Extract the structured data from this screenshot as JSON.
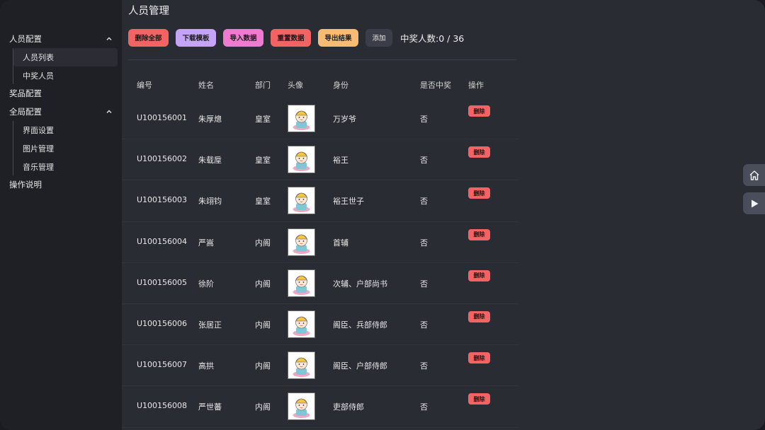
{
  "sidebar": {
    "groups": [
      {
        "label": "人员配置",
        "items": [
          "人员列表",
          "中奖人员"
        ]
      },
      {
        "label": "奖品配置"
      },
      {
        "label": "全局配置",
        "items": [
          "界面设置",
          "图片管理",
          "音乐管理"
        ]
      },
      {
        "label": "操作说明"
      }
    ]
  },
  "header": {
    "title": "人员管理"
  },
  "toolbar": {
    "delete_all": "删除全部",
    "download_template": "下载模板",
    "import_data": "导入数据",
    "reset_data": "重置数据",
    "export_results": "导出结果",
    "add": "添加",
    "winners_label": "中奖人数:0 / 36"
  },
  "table": {
    "headers": [
      "编号",
      "姓名",
      "部门",
      "头像",
      "身份",
      "是否中奖",
      "操作"
    ],
    "rows": [
      {
        "id": "U100156001",
        "name": "朱厚熜",
        "dept": "皇室",
        "role": "万岁爷",
        "won": "否",
        "action": "删除"
      },
      {
        "id": "U100156002",
        "name": "朱载垕",
        "dept": "皇室",
        "role": "裕王",
        "won": "否",
        "action": "删除"
      },
      {
        "id": "U100156003",
        "name": "朱翊钧",
        "dept": "皇室",
        "role": "裕王世子",
        "won": "否",
        "action": "删除"
      },
      {
        "id": "U100156004",
        "name": "严嵩",
        "dept": "内阁",
        "role": "首辅",
        "won": "否",
        "action": "删除"
      },
      {
        "id": "U100156005",
        "name": "徐阶",
        "dept": "内阁",
        "role": "次辅、户部尚书",
        "won": "否",
        "action": "删除"
      },
      {
        "id": "U100156006",
        "name": "张居正",
        "dept": "内阁",
        "role": "阁臣、兵部侍郎",
        "won": "否",
        "action": "删除"
      },
      {
        "id": "U100156007",
        "name": "高拱",
        "dept": "内阁",
        "role": "阁臣、户部侍郎",
        "won": "否",
        "action": "删除"
      },
      {
        "id": "U100156008",
        "name": "严世蕃",
        "dept": "内阁",
        "role": "吏部侍郎",
        "won": "否",
        "action": "删除"
      }
    ]
  },
  "floating": {
    "icons": [
      "home-icon",
      "play-icon"
    ]
  },
  "colors": {
    "danger": "#f26363",
    "purple": "#c5a4f7",
    "pink": "#ef7bd1",
    "orange": "#f7bb74"
  }
}
